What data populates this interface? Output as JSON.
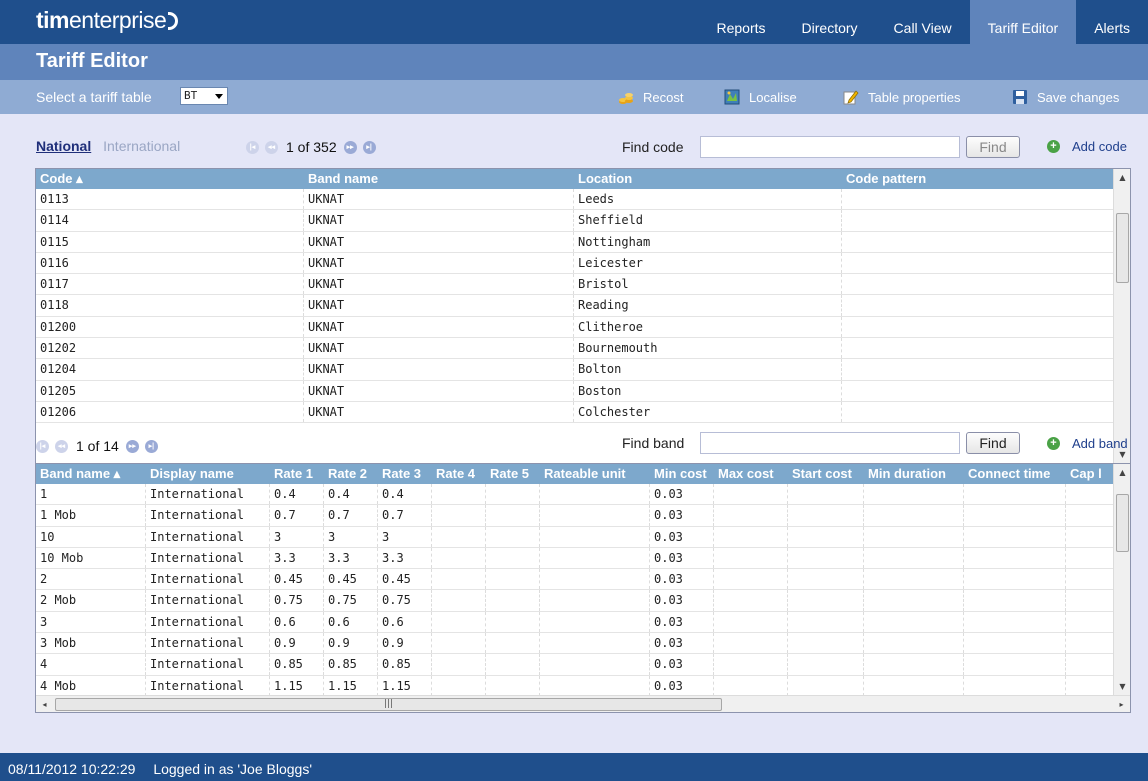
{
  "app": {
    "logo_bold": "tim",
    "logo_rest": "enterprise"
  },
  "nav": [
    {
      "label": "Reports",
      "active": false
    },
    {
      "label": "Directory",
      "active": false
    },
    {
      "label": "Call View",
      "active": false
    },
    {
      "label": "Tariff Editor",
      "active": true
    },
    {
      "label": "Alerts",
      "active": false
    }
  ],
  "page": {
    "title": "Tariff Editor"
  },
  "toolbar": {
    "select_label": "Select a tariff table",
    "select_value": "BT",
    "actions": [
      {
        "label": "Recost",
        "icon": "coins-icon"
      },
      {
        "label": "Localise",
        "icon": "map-icon"
      },
      {
        "label": "Table properties",
        "icon": "pencil-icon"
      },
      {
        "label": "Save changes",
        "icon": "floppy-disk-icon"
      }
    ]
  },
  "codes": {
    "tabs": {
      "active": "National",
      "inactive": "International"
    },
    "pager": "1 of 352",
    "find_label": "Find code",
    "find_value": "",
    "find_button": "Find",
    "add_label": "Add code",
    "columns": [
      "Code ▴",
      "Band name",
      "Location",
      "Code pattern"
    ],
    "rows": [
      [
        "0113",
        "UKNAT",
        "Leeds",
        ""
      ],
      [
        "0114",
        "UKNAT",
        "Sheffield",
        ""
      ],
      [
        "0115",
        "UKNAT",
        "Nottingham",
        ""
      ],
      [
        "0116",
        "UKNAT",
        "Leicester",
        ""
      ],
      [
        "0117",
        "UKNAT",
        "Bristol",
        ""
      ],
      [
        "0118",
        "UKNAT",
        "Reading",
        ""
      ],
      [
        "01200",
        "UKNAT",
        "Clitheroe",
        ""
      ],
      [
        "01202",
        "UKNAT",
        "Bournemouth",
        ""
      ],
      [
        "01204",
        "UKNAT",
        "Bolton",
        ""
      ],
      [
        "01205",
        "UKNAT",
        "Boston",
        ""
      ],
      [
        "01206",
        "UKNAT",
        "Colchester",
        ""
      ]
    ]
  },
  "bands": {
    "pager": "1 of 14",
    "find_label": "Find band",
    "find_value": "",
    "find_button": "Find",
    "add_label": "Add band",
    "columns": [
      "Band name ▴",
      "Display name",
      "Rate 1",
      "Rate 2",
      "Rate 3",
      "Rate 4",
      "Rate 5",
      "Rateable unit",
      "Min cost",
      "Max cost",
      "Start cost",
      "Min duration",
      "Connect time",
      "Cap l"
    ],
    "rows": [
      [
        "1",
        "International",
        "0.4",
        "0.4",
        "0.4",
        "",
        "",
        "",
        "0.03",
        "",
        "",
        "",
        "",
        ""
      ],
      [
        "1 Mob",
        "International",
        "0.7",
        "0.7",
        "0.7",
        "",
        "",
        "",
        "0.03",
        "",
        "",
        "",
        "",
        ""
      ],
      [
        "10",
        "International",
        "3",
        "3",
        "3",
        "",
        "",
        "",
        "0.03",
        "",
        "",
        "",
        "",
        ""
      ],
      [
        "10 Mob",
        "International",
        "3.3",
        "3.3",
        "3.3",
        "",
        "",
        "",
        "0.03",
        "",
        "",
        "",
        "",
        ""
      ],
      [
        "2",
        "International",
        "0.45",
        "0.45",
        "0.45",
        "",
        "",
        "",
        "0.03",
        "",
        "",
        "",
        "",
        ""
      ],
      [
        "2 Mob",
        "International",
        "0.75",
        "0.75",
        "0.75",
        "",
        "",
        "",
        "0.03",
        "",
        "",
        "",
        "",
        ""
      ],
      [
        "3",
        "International",
        "0.6",
        "0.6",
        "0.6",
        "",
        "",
        "",
        "0.03",
        "",
        "",
        "",
        "",
        ""
      ],
      [
        "3 Mob",
        "International",
        "0.9",
        "0.9",
        "0.9",
        "",
        "",
        "",
        "0.03",
        "",
        "",
        "",
        "",
        ""
      ],
      [
        "4",
        "International",
        "0.85",
        "0.85",
        "0.85",
        "",
        "",
        "",
        "0.03",
        "",
        "",
        "",
        "",
        ""
      ],
      [
        "4 Mob",
        "International",
        "1.15",
        "1.15",
        "1.15",
        "",
        "",
        "",
        "0.03",
        "",
        "",
        "",
        "",
        ""
      ]
    ]
  },
  "footer": {
    "datetime": "08/11/2012 10:22:29",
    "user": "Logged in as 'Joe Bloggs'"
  },
  "colors": {
    "top_bar": "#1f4f8c",
    "title_bar": "#5f84bb",
    "toolbar": "#8fabd3",
    "content_bg": "#e4e6f7",
    "grid_header": "#7da8cc",
    "add_icon": "#4aa246"
  }
}
